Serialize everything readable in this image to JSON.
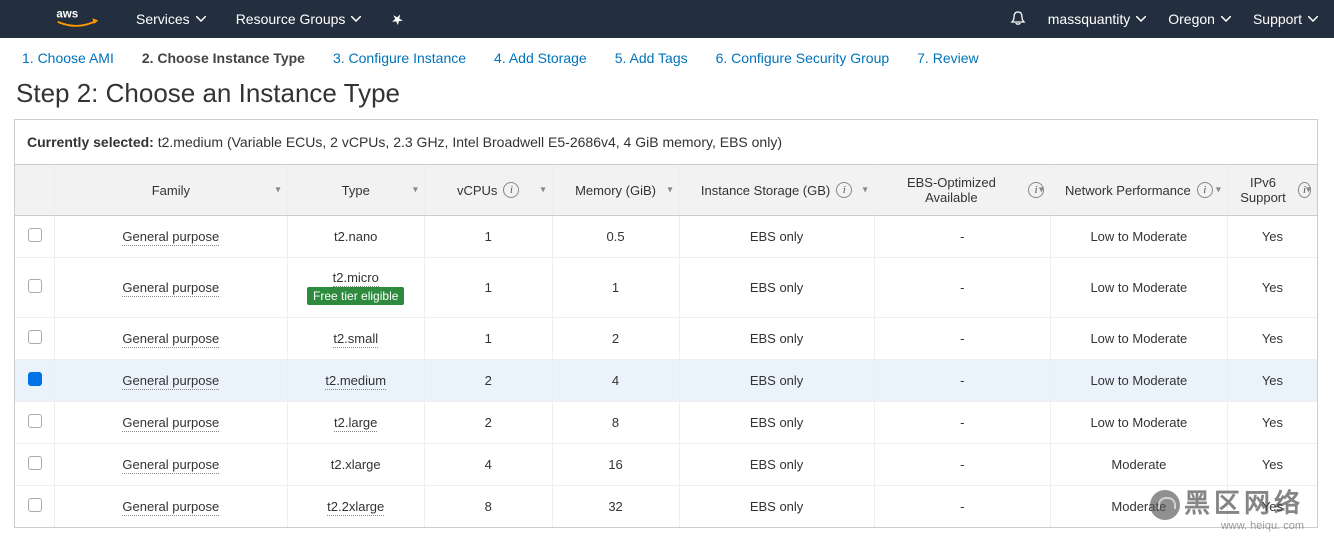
{
  "topbar": {
    "services": "Services",
    "resource_groups": "Resource Groups",
    "account": "massquantity",
    "region": "Oregon",
    "support": "Support"
  },
  "wizard": {
    "step1": "1. Choose AMI",
    "step2": "2. Choose Instance Type",
    "step3": "3. Configure Instance",
    "step4": "4. Add Storage",
    "step5": "5. Add Tags",
    "step6": "6. Configure Security Group",
    "step7": "7. Review"
  },
  "page": {
    "title": "Step 2: Choose an Instance Type",
    "currently_selected_label": "Currently selected:",
    "currently_selected_value": "t2.medium (Variable ECUs, 2 vCPUs, 2.3 GHz, Intel Broadwell E5-2686v4, 4 GiB memory, EBS only)"
  },
  "table": {
    "headers": {
      "family": "Family",
      "type": "Type",
      "vcpus": "vCPUs",
      "memory": "Memory (GiB)",
      "storage": "Instance Storage (GB)",
      "ebs": "EBS-Optimized Available",
      "network": "Network Performance",
      "ipv6": "IPv6 Support"
    },
    "free_tier_badge": "Free tier eligible",
    "rows": [
      {
        "family": "General purpose",
        "type": "t2.nano",
        "vcpus": "1",
        "memory": "0.5",
        "storage": "EBS only",
        "ebs": "-",
        "network": "Low to Moderate",
        "ipv6": "Yes",
        "selected": false,
        "free_tier": false,
        "dotted_type": false
      },
      {
        "family": "General purpose",
        "type": "t2.micro",
        "vcpus": "1",
        "memory": "1",
        "storage": "EBS only",
        "ebs": "-",
        "network": "Low to Moderate",
        "ipv6": "Yes",
        "selected": false,
        "free_tier": true,
        "dotted_type": true
      },
      {
        "family": "General purpose",
        "type": "t2.small",
        "vcpus": "1",
        "memory": "2",
        "storage": "EBS only",
        "ebs": "-",
        "network": "Low to Moderate",
        "ipv6": "Yes",
        "selected": false,
        "free_tier": false,
        "dotted_type": true
      },
      {
        "family": "General purpose",
        "type": "t2.medium",
        "vcpus": "2",
        "memory": "4",
        "storage": "EBS only",
        "ebs": "-",
        "network": "Low to Moderate",
        "ipv6": "Yes",
        "selected": true,
        "free_tier": false,
        "dotted_type": true
      },
      {
        "family": "General purpose",
        "type": "t2.large",
        "vcpus": "2",
        "memory": "8",
        "storage": "EBS only",
        "ebs": "-",
        "network": "Low to Moderate",
        "ipv6": "Yes",
        "selected": false,
        "free_tier": false,
        "dotted_type": true
      },
      {
        "family": "General purpose",
        "type": "t2.xlarge",
        "vcpus": "4",
        "memory": "16",
        "storage": "EBS only",
        "ebs": "-",
        "network": "Moderate",
        "ipv6": "Yes",
        "selected": false,
        "free_tier": false,
        "dotted_type": false
      },
      {
        "family": "General purpose",
        "type": "t2.2xlarge",
        "vcpus": "8",
        "memory": "32",
        "storage": "EBS only",
        "ebs": "-",
        "network": "Moderate",
        "ipv6": "Yes",
        "selected": false,
        "free_tier": false,
        "dotted_type": true
      }
    ]
  },
  "watermark": {
    "main": "黑区网络",
    "sub": "www. heiqu. com"
  }
}
